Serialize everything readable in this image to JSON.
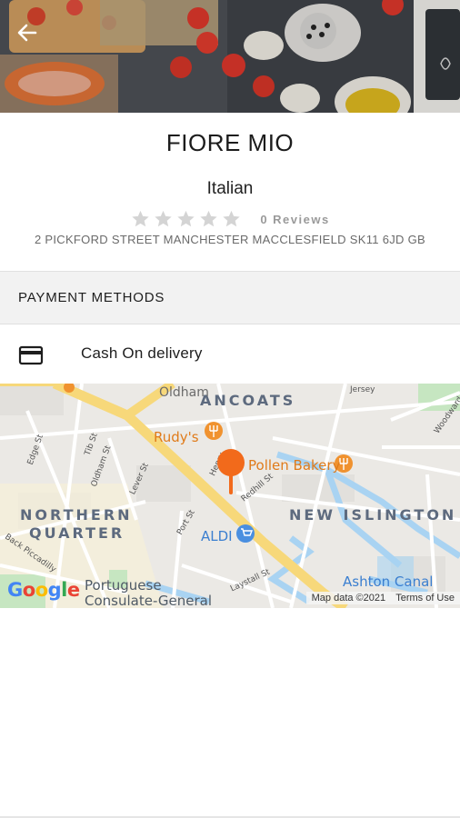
{
  "header": {
    "back_icon": "arrow-left-icon"
  },
  "restaurant": {
    "name": "FIORE MIO",
    "cuisine": "Italian",
    "rating_stars": 0,
    "reviews": "0 Reviews",
    "address": "2 PICKFORD STREET MANCHESTER MACCLESFIELD SK11 6JD GB"
  },
  "payment": {
    "section_title": "PAYMENT METHODS",
    "method_label": "Cash On delivery",
    "method_icon": "credit-card-icon"
  },
  "map": {
    "areas": {
      "ancoats": "ANCOATS",
      "northern_quarter_1": "NORTHERN",
      "northern_quarter_2": "QUARTER",
      "new_islington": "NEW ISLINGTON"
    },
    "pois": {
      "rudys": "Rudy's",
      "pollen": "Pollen Bakery",
      "aldi": "ALDI",
      "ashton_canal": "Ashton Canal",
      "consulate_1": "Portuguese",
      "consulate_2": "Consulate-General"
    },
    "streets": {
      "oldham": "Oldham",
      "jersey": "Jersey",
      "woodward": "Woodward",
      "edge": "Edge St",
      "tib": "Tib St",
      "oldham_st": "Oldham St",
      "lever": "Lever St",
      "port": "Port St",
      "redhill": "Redhill St",
      "laystall": "Laystall St",
      "piccadilly": "Back Piccadilly",
      "henry": "Henry"
    },
    "google_logo": "Google",
    "map_data": "Map data ©2021",
    "terms": "Terms of Use",
    "pin_icon": "map-pin-icon"
  },
  "colors": {
    "pin": "#f26a1b",
    "road_major": "#f7d87a",
    "water": "#a9d3f2",
    "section_bg": "#f2f2f2"
  }
}
